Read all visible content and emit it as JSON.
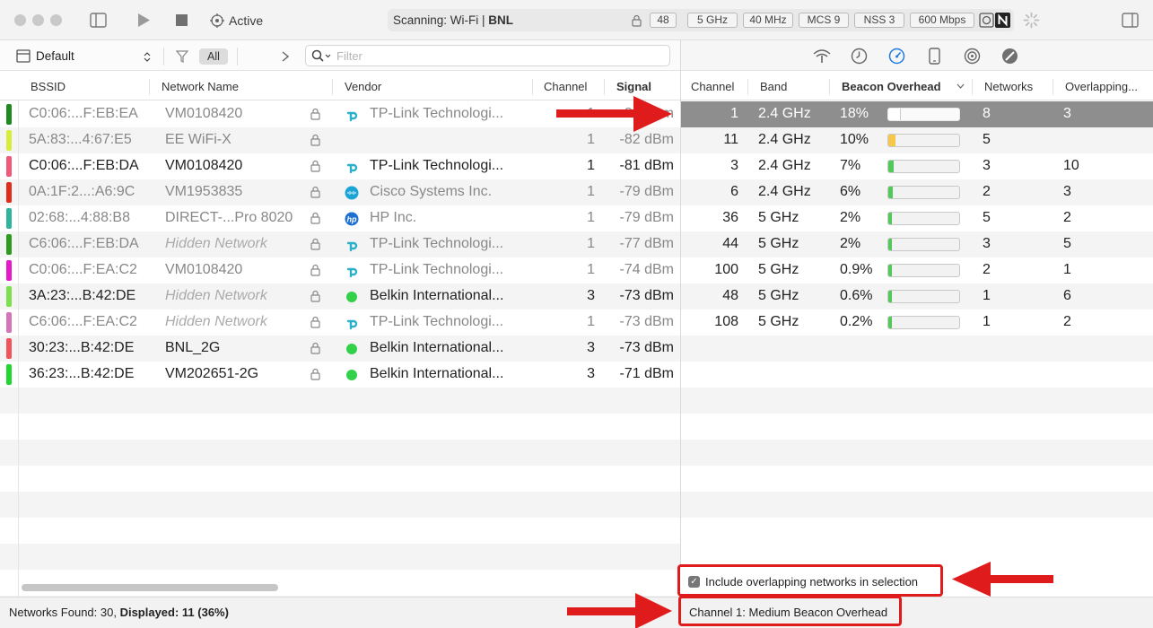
{
  "toolbar": {
    "active_label": "Active",
    "scan_prefix": "Scanning: Wi-Fi  |  ",
    "scan_network": "BNL",
    "pills": [
      "48",
      "5 GHz",
      "40 MHz",
      "MCS 9",
      "NSS 3",
      "600 Mbps"
    ]
  },
  "filterbar": {
    "preset": "Default",
    "all_chip": "All",
    "filter_placeholder": "Filter"
  },
  "left_table": {
    "headers": [
      "BSSID",
      "Network Name",
      "Vendor",
      "Channel",
      "Signal"
    ],
    "rows": [
      {
        "color": "#1f8a1f",
        "bssid": "C0:06:...F:EB:EA",
        "name": "VM0108420",
        "vendor": "TP-Link Technologi...",
        "vendor_icon": "tplink",
        "channel": "1",
        "signal": "-82 dBm",
        "dim": true,
        "hidden": false
      },
      {
        "color": "#d8ec3c",
        "bssid": "5A:83:...4:67:E5",
        "name": "EE WiFi-X",
        "vendor": "",
        "vendor_icon": "",
        "channel": "1",
        "signal": "-82 dBm",
        "dim": true,
        "hidden": false
      },
      {
        "color": "#f0597a",
        "bssid": "C0:06:...F:EB:DA",
        "name": "VM0108420",
        "vendor": "TP-Link Technologi...",
        "vendor_icon": "tplink",
        "channel": "1",
        "signal": "-81 dBm",
        "dim": false,
        "hidden": false
      },
      {
        "color": "#e02d1b",
        "bssid": "0A:1F:2...:A6:9C",
        "name": "VM1953835",
        "vendor": "Cisco Systems Inc.",
        "vendor_icon": "cisco",
        "channel": "1",
        "signal": "-79 dBm",
        "dim": true,
        "hidden": false
      },
      {
        "color": "#2cb59a",
        "bssid": "02:68:...4:88:B8",
        "name": "DIRECT-...Pro 8020",
        "vendor": "HP Inc.",
        "vendor_icon": "hp",
        "channel": "1",
        "signal": "-79 dBm",
        "dim": true,
        "hidden": false
      },
      {
        "color": "#2e9a1e",
        "bssid": "C6:06:...F:EB:DA",
        "name": "Hidden Network",
        "vendor": "TP-Link Technologi...",
        "vendor_icon": "tplink",
        "channel": "1",
        "signal": "-77 dBm",
        "dim": true,
        "hidden": true
      },
      {
        "color": "#e619c9",
        "bssid": "C0:06:...F:EA:C2",
        "name": "VM0108420",
        "vendor": "TP-Link Technologi...",
        "vendor_icon": "tplink",
        "channel": "1",
        "signal": "-74 dBm",
        "dim": true,
        "hidden": false
      },
      {
        "color": "#7be04b",
        "bssid": "3A:23:...B:42:DE",
        "name": "Hidden Network",
        "vendor": "Belkin International...",
        "vendor_icon": "belkin",
        "channel": "3",
        "signal": "-73 dBm",
        "dim": false,
        "hidden": true
      },
      {
        "color": "#d674b8",
        "bssid": "C6:06:...F:EA:C2",
        "name": "Hidden Network",
        "vendor": "TP-Link Technologi...",
        "vendor_icon": "tplink",
        "channel": "1",
        "signal": "-73 dBm",
        "dim": true,
        "hidden": true
      },
      {
        "color": "#f2545b",
        "bssid": "30:23:...B:42:DE",
        "name": "BNL_2G",
        "vendor": "Belkin International...",
        "vendor_icon": "belkin",
        "channel": "3",
        "signal": "-73 dBm",
        "dim": false,
        "hidden": false
      },
      {
        "color": "#22d630",
        "bssid": "36:23:...B:42:DE",
        "name": "VM202651-2G",
        "vendor": "Belkin International...",
        "vendor_icon": "belkin",
        "channel": "3",
        "signal": "-71 dBm",
        "dim": false,
        "hidden": false
      }
    ]
  },
  "right_table": {
    "headers": [
      "Channel",
      "Band",
      "Beacon Overhead",
      "Networks",
      "Overlapping..."
    ],
    "rows": [
      {
        "channel": "1",
        "band": "2.4 GHz",
        "overhead": "18%",
        "fill": 0.18,
        "fill_color": "#ffffff",
        "networks": "8",
        "overlapping": "3",
        "selected": true
      },
      {
        "channel": "11",
        "band": "2.4 GHz",
        "overhead": "10%",
        "fill": 0.1,
        "fill_color": "#f5c84a",
        "networks": "5",
        "overlapping": "",
        "selected": false
      },
      {
        "channel": "3",
        "band": "2.4 GHz",
        "overhead": "7%",
        "fill": 0.07,
        "fill_color": "#52c95a",
        "networks": "3",
        "overlapping": "10",
        "selected": false
      },
      {
        "channel": "6",
        "band": "2.4 GHz",
        "overhead": "6%",
        "fill": 0.06,
        "fill_color": "#52c95a",
        "networks": "2",
        "overlapping": "3",
        "selected": false
      },
      {
        "channel": "36",
        "band": "5 GHz",
        "overhead": "2%",
        "fill": 0.02,
        "fill_color": "#52c95a",
        "networks": "5",
        "overlapping": "2",
        "selected": false
      },
      {
        "channel": "44",
        "band": "5 GHz",
        "overhead": "2%",
        "fill": 0.02,
        "fill_color": "#52c95a",
        "networks": "3",
        "overlapping": "5",
        "selected": false
      },
      {
        "channel": "100",
        "band": "5 GHz",
        "overhead": "0.9%",
        "fill": 0.009,
        "fill_color": "#52c95a",
        "networks": "2",
        "overlapping": "1",
        "selected": false
      },
      {
        "channel": "48",
        "band": "5 GHz",
        "overhead": "0.6%",
        "fill": 0.006,
        "fill_color": "#52c95a",
        "networks": "1",
        "overlapping": "6",
        "selected": false
      },
      {
        "channel": "108",
        "band": "5 GHz",
        "overhead": "0.2%",
        "fill": 0.002,
        "fill_color": "#52c95a",
        "networks": "1",
        "overlapping": "2",
        "selected": false
      }
    ]
  },
  "overlap_option": {
    "label": "Include overlapping networks in selection",
    "checked": true
  },
  "status": {
    "networks_found_prefix": "Networks Found: 30, ",
    "displayed": "Displayed: 11 (36%)",
    "channel_summary": "Channel 1: Medium Beacon Overhead"
  },
  "colors": {
    "annotation_red": "#e01b1b",
    "selected_row": "#8e8e8e",
    "accent_blue": "#1e7be0"
  }
}
